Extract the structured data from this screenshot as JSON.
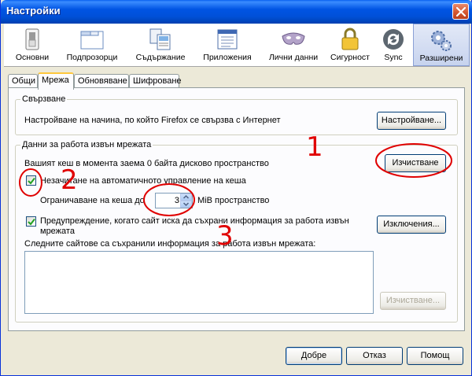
{
  "window": {
    "title": "Настройки"
  },
  "toolbar": {
    "panes": [
      {
        "label": "Основни",
        "icon": "switch-icon"
      },
      {
        "label": "Подпрозорци",
        "icon": "windows-icon"
      },
      {
        "label": "Съдържание",
        "icon": "content-icon"
      },
      {
        "label": "Приложения",
        "icon": "applications-icon"
      },
      {
        "label": "Лични данни",
        "icon": "privacy-mask-icon"
      },
      {
        "label": "Сигурност",
        "icon": "padlock-icon"
      },
      {
        "label": "Sync",
        "icon": "sync-icon"
      },
      {
        "label": "Разширени",
        "icon": "gears-icon",
        "active": true
      }
    ]
  },
  "tabs": [
    {
      "label": "Общи"
    },
    {
      "label": "Мрежа",
      "active": true
    },
    {
      "label": "Обновяване"
    },
    {
      "label": "Шифроване"
    }
  ],
  "connection": {
    "legend": "Свързване",
    "description": "Настройване на начина, по който Firefox се свързва с Интернет",
    "settings_button": "Настройване..."
  },
  "offline": {
    "legend": "Данни за работа извън мрежата",
    "cache_text": "Вашият кеш в момента заема 0 байта дисково пространство",
    "clear_button": "Изчистване",
    "override_label": "Незачитане на автоматичното управление на кеша",
    "override_checked": true,
    "limit_prefix": "Ограничаване на кеша до",
    "limit_value": "3",
    "limit_suffix": "MiB пространство",
    "warn_label_line1": "Предупреждение, когато сайт иска да съхрани информация за работа извън",
    "warn_label_line2": "мрежата",
    "warn_checked": true,
    "exceptions_button": "Изключения...",
    "sites_label": "Следните сайтове са съхранили информация за работа извън мрежата:",
    "sites_clear_button": "Изчистване..."
  },
  "footer": {
    "ok": "Добре",
    "cancel": "Отказ",
    "help": "Помощ"
  },
  "annotations": {
    "label1": "1",
    "label2": "2",
    "label3": "3",
    "color": "#e00000"
  }
}
